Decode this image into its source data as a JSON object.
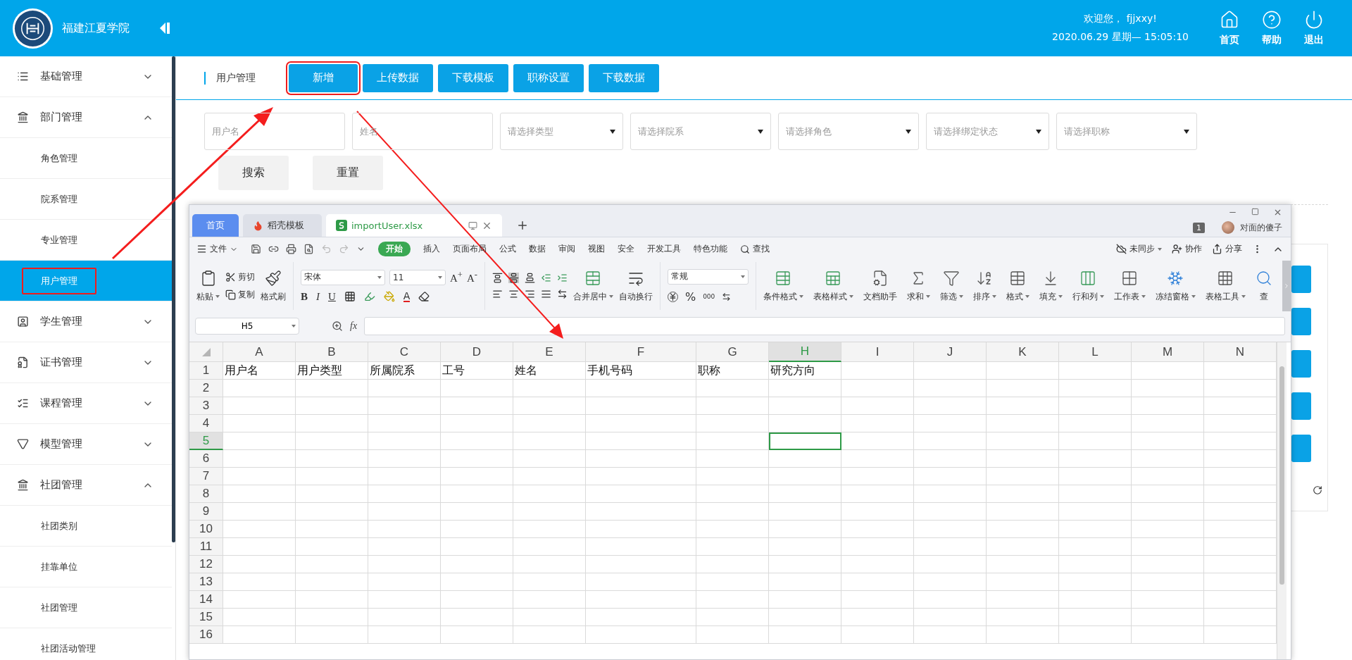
{
  "header": {
    "school_name": "福建江夏学院",
    "welcome": "欢迎您， fjjxxy!",
    "datetime": "2020.06.29 星期— 15:05:10",
    "actions": [
      {
        "label": "首页",
        "kind": "home"
      },
      {
        "label": "帮助",
        "kind": "help"
      },
      {
        "label": "退出",
        "kind": "logout"
      }
    ]
  },
  "sidebar": {
    "items": [
      {
        "label": "基础管理",
        "kind": "list",
        "expanded": false
      },
      {
        "label": "部门管理",
        "kind": "bank",
        "expanded": true,
        "children": [
          {
            "label": "角色管理",
            "selected": false
          },
          {
            "label": "院系管理",
            "selected": false
          },
          {
            "label": "专业管理",
            "selected": false
          },
          {
            "label": "用户管理",
            "selected": true,
            "annotated": true
          }
        ]
      },
      {
        "label": "学生管理",
        "kind": "student",
        "expanded": false
      },
      {
        "label": "证书管理",
        "kind": "certificate",
        "expanded": false
      },
      {
        "label": "课程管理",
        "kind": "course",
        "expanded": false
      },
      {
        "label": "模型管理",
        "kind": "model",
        "expanded": false
      },
      {
        "label": "社团管理",
        "kind": "bank",
        "expanded": true,
        "children": [
          {
            "label": "社团类别",
            "selected": false
          },
          {
            "label": "挂靠单位",
            "selected": false
          },
          {
            "label": "社团管理",
            "selected": false
          },
          {
            "label": "社团活动管理",
            "selected": false
          }
        ]
      }
    ]
  },
  "breadcrumb": "用户管理",
  "toolbar": [
    {
      "label": "新增",
      "annotated": true
    },
    {
      "label": "上传数据",
      "annotated": false
    },
    {
      "label": "下载模板",
      "annotated": false
    },
    {
      "label": "职称设置",
      "annotated": false
    },
    {
      "label": "下载数据",
      "annotated": false
    }
  ],
  "filters": [
    {
      "kind": "text",
      "placeholder": "用户名"
    },
    {
      "kind": "text",
      "placeholder": "姓名"
    },
    {
      "kind": "select",
      "placeholder": "请选择类型"
    },
    {
      "kind": "select",
      "placeholder": "请选择院系"
    },
    {
      "kind": "select",
      "placeholder": "请选择角色"
    },
    {
      "kind": "select",
      "placeholder": "请选择绑定状态"
    },
    {
      "kind": "select",
      "placeholder": "请选择职称"
    }
  ],
  "filter_buttons": [
    "搜索",
    "重置"
  ],
  "spreadsheet": {
    "tabs": [
      {
        "label": "首页",
        "kind": "home",
        "selected": false
      },
      {
        "label": "稻壳模板",
        "kind": "docer",
        "selected": false
      },
      {
        "label": "importUser.xlsx",
        "kind": "sheet",
        "selected": true
      }
    ],
    "window_count": "1",
    "user": "对面的傻子",
    "file_menu": "文件",
    "ribbon_tabs": [
      {
        "label": "开始",
        "selected": true
      },
      {
        "label": "插入",
        "selected": false
      },
      {
        "label": "页面布局",
        "selected": false
      },
      {
        "label": "公式",
        "selected": false
      },
      {
        "label": "数据",
        "selected": false
      },
      {
        "label": "审阅",
        "selected": false
      },
      {
        "label": "视图",
        "selected": false
      },
      {
        "label": "安全",
        "selected": false
      },
      {
        "label": "开发工具",
        "selected": false
      },
      {
        "label": "特色功能",
        "selected": false
      }
    ],
    "find": "查找",
    "sync": "未同步",
    "collab": "协作",
    "share": "分享",
    "ribbon": {
      "paste": "粘贴",
      "cut": "剪切",
      "copy": "复制",
      "format_painter": "格式刷",
      "font": "宋体",
      "font_size": "11",
      "grow_font": "A$^{+}$",
      "shrink_font": "A$^{-}$",
      "styles": [
        "B",
        "I",
        "U"
      ],
      "font_color": "A",
      "merge": "合并居中",
      "wrap": "自动换行",
      "number_format": "常规",
      "percent": "%",
      "thousands": "000",
      "tools": [
        {
          "label": "条件格式",
          "kind": "conditional",
          "dropdown": true
        },
        {
          "label": "表格样式",
          "kind": "style",
          "dropdown": true
        },
        {
          "label": "文档助手",
          "kind": "helper",
          "dropdown": false
        },
        {
          "label": "求和",
          "kind": "sum",
          "dropdown": true
        },
        {
          "label": "筛选",
          "kind": "filter",
          "dropdown": true
        },
        {
          "label": "排序",
          "kind": "sort",
          "dropdown": true
        },
        {
          "label": "格式",
          "kind": "format",
          "dropdown": true
        },
        {
          "label": "填充",
          "kind": "fill",
          "dropdown": true
        },
        {
          "label": "行和列",
          "kind": "rowcol",
          "dropdown": true
        },
        {
          "label": "工作表",
          "kind": "sheet",
          "dropdown": true
        },
        {
          "label": "冻结窗格",
          "kind": "freeze",
          "dropdown": true
        },
        {
          "label": "表格工具",
          "kind": "tools",
          "dropdown": true
        },
        {
          "label": "查",
          "kind": "find",
          "dropdown": false
        }
      ]
    },
    "name_box": "H5",
    "fx": "fx",
    "columns": [
      {
        "label": "A",
        "selected": false
      },
      {
        "label": "B",
        "selected": false
      },
      {
        "label": "C",
        "selected": false
      },
      {
        "label": "D",
        "selected": false
      },
      {
        "label": "E",
        "selected": false
      },
      {
        "label": "F",
        "selected": false
      },
      {
        "label": "G",
        "selected": false
      },
      {
        "label": "H",
        "selected": true
      },
      {
        "label": "I",
        "selected": false
      },
      {
        "label": "J",
        "selected": false
      },
      {
        "label": "K",
        "selected": false
      },
      {
        "label": "L",
        "selected": false
      },
      {
        "label": "M",
        "selected": false
      },
      {
        "label": "N",
        "selected": false
      }
    ],
    "rows": [
      {
        "label": "1",
        "selected": false,
        "cells": [
          "用户名",
          "用户类型",
          "所属院系",
          "工号",
          "姓名",
          "手机号码",
          "职称",
          "研究方向"
        ]
      },
      {
        "label": "2",
        "selected": false
      },
      {
        "label": "3",
        "selected": false
      },
      {
        "label": "4",
        "selected": false
      },
      {
        "label": "5",
        "selected": true
      },
      {
        "label": "6",
        "selected": false
      },
      {
        "label": "7",
        "selected": false
      },
      {
        "label": "8",
        "selected": false
      },
      {
        "label": "9",
        "selected": false
      },
      {
        "label": "10",
        "selected": false
      },
      {
        "label": "11",
        "selected": false
      },
      {
        "label": "12",
        "selected": false
      },
      {
        "label": "13",
        "selected": false
      },
      {
        "label": "14",
        "selected": false
      },
      {
        "label": "15",
        "selected": false
      },
      {
        "label": "16",
        "selected": false
      }
    ]
  }
}
